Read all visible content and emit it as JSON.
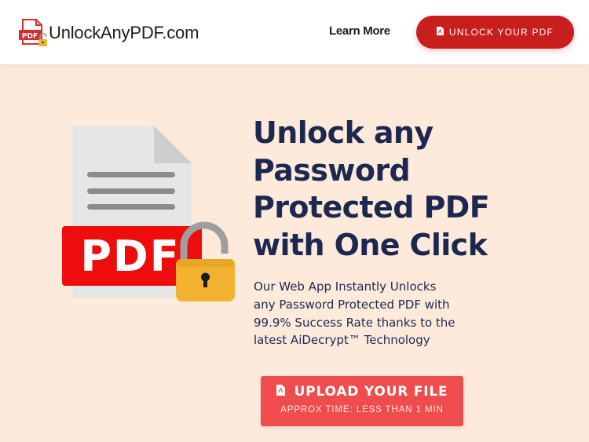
{
  "header": {
    "logo_text": "UnlockAnyPDF.com",
    "logo_badge": "PDF",
    "learn_more": "Learn More",
    "cta": "UNLOCK YOUR PDF"
  },
  "hero": {
    "illustration_label": "PDF",
    "headline_lines": [
      "Unlock any",
      "Password",
      "Protected PDF",
      "with One Click"
    ],
    "subtext_lines": [
      "Our Web App Instantly Unlocks",
      "any Password Protected PDF with",
      "99.9% Success Rate thanks to the",
      "latest AiDecrypt™ Technology"
    ],
    "upload_button": {
      "label": "UPLOAD YOUR FILE",
      "sublabel": "APPROX TIME: LESS THAN 1 MIN"
    }
  },
  "colors": {
    "page_bg": "#fdeadb",
    "brand_red": "#c81e1e",
    "button_red": "#ef4d4d",
    "headline_navy": "#1d2850",
    "lock_gold": "#f2b12f"
  },
  "icons": {
    "logo": "pdf-lock-icon",
    "button_icon": "pdf-file-icon",
    "illustration": "pdf-unlocked-illustration"
  }
}
